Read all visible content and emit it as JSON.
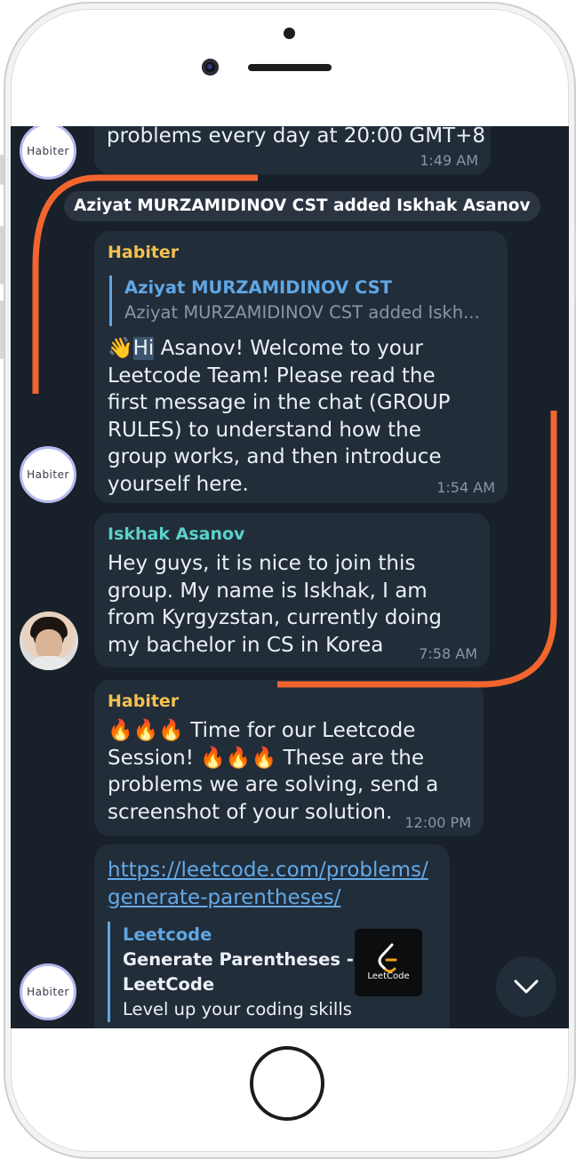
{
  "chat": {
    "prev_message_tail": "problems every day at 20:00 GMT+8",
    "prev_time": "1:49 AM",
    "service_message": "Aziyat MURZAMIDINOV CST added Iskhak Asanov",
    "avatar_label": "Habiter",
    "messages": [
      {
        "sender": "Habiter",
        "reply_name": "Aziyat MURZAMIDINOV CST",
        "reply_text": "Aziyat MURZAMIDINOV CST added Iskh...",
        "emoji": "👋",
        "highlight": "Hi",
        "text_rest": " Asanov! Welcome to your Leetcode Team! Please read the first message in the chat (GROUP RULES) to understand how the group works, and then introduce yourself here.",
        "time": "1:54 AM"
      },
      {
        "sender": "Iskhak Asanov",
        "text": "Hey guys, it is nice to join this group. My name is Iskhak, I am from Kyrgyzstan, currently doing my bachelor in CS in Korea",
        "time": "7:58 AM"
      },
      {
        "sender": "Habiter",
        "text": "🔥🔥🔥 Time for our Leetcode Session! 🔥🔥🔥 These are the problems we are solving, send a screenshot of your solution.",
        "time": "12:00 PM"
      },
      {
        "link": "https://leetcode.com/problems/generate-parentheses/",
        "preview_site": "Leetcode",
        "preview_title": "Generate Parentheses - LeetCode",
        "preview_desc": "Level up your coding skills",
        "thumb_label": "LeetCode"
      }
    ]
  },
  "colors": {
    "background": "#18202a",
    "bubble": "#222d3a",
    "habiter_name": "#f2c14e",
    "iskhak_name": "#5bd1c9",
    "link": "#62a9e8",
    "annotation": "#f2652f"
  },
  "icons": {
    "scroll_down": "chevron-down-icon"
  }
}
